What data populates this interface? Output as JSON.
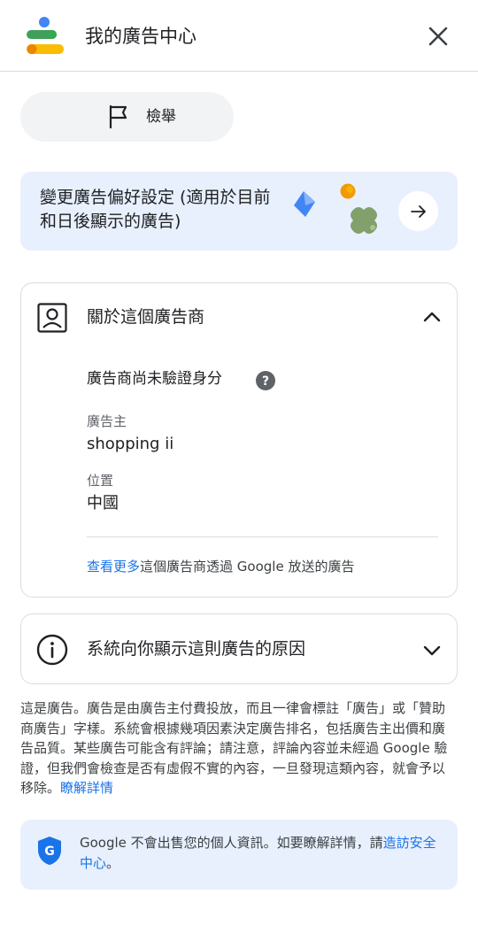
{
  "header": {
    "title": "我的廣告中心",
    "logo_icon": "my-ad-center-logo-icon",
    "close_icon": "close-icon"
  },
  "report": {
    "label": "檢舉",
    "icon": "flag-icon"
  },
  "preferences_card": {
    "text": "變更廣告偏好設定 (適用於目前和日後顯示的廣告)",
    "arrow_icon": "arrow-right-icon"
  },
  "advertiser_section": {
    "title": "關於這個廣告商",
    "icon": "person-icon",
    "verification_status": "廣告商尚未驗證身分",
    "help_icon": "help-icon",
    "advertiser_label": "廣告主",
    "advertiser_value": "shopping ii",
    "location_label": "位置",
    "location_value": "中國",
    "see_more_link": "查看更多",
    "see_more_rest": "這個廣告商透過 Google 放送的廣告"
  },
  "why_section": {
    "title": "系統向你顯示這則廣告的原因",
    "icon": "info-icon"
  },
  "disclaimer": {
    "text": "這是廣告。廣告是由廣告主付費投放，而且一律會標註「廣告」或「贊助商廣告」字樣。系統會根據幾項因素決定廣告排名，包括廣告主出價和廣告品質。某些廣告可能含有評論；請注意，評論內容並未經過 Google 驗證，但我們會檢查是否有虛假不實的內容，一旦發現這類內容，就會予以移除。",
    "link": "瞭解詳情"
  },
  "privacy": {
    "text": "Google 不會出售您的個人資訊。如要瞭解詳情，請",
    "link": "造訪安全中心",
    "suffix": "。",
    "icon": "shield-icon"
  },
  "colors": {
    "link": "#1a73e8",
    "card_blue": "#e8f0fe",
    "text_secondary": "#5f6368"
  }
}
